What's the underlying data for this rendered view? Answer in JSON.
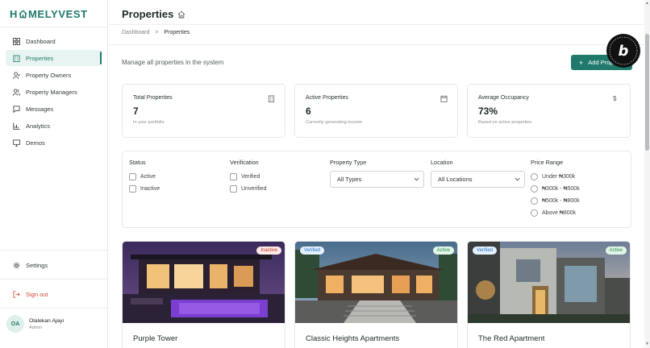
{
  "brand": {
    "logo_left": "H",
    "logo_right": "MELYVEST",
    "accent": "#1f7a6b"
  },
  "sidebar": {
    "items": [
      {
        "label": "Dashboard",
        "icon": "dashboard-icon"
      },
      {
        "label": "Properties",
        "icon": "building-icon",
        "active": true
      },
      {
        "label": "Property Owners",
        "icon": "user-check-icon"
      },
      {
        "label": "Property Managers",
        "icon": "users-icon"
      },
      {
        "label": "Messages",
        "icon": "message-icon"
      },
      {
        "label": "Analytics",
        "icon": "bar-chart-icon"
      },
      {
        "label": "Demos",
        "icon": "monitor-icon"
      }
    ],
    "settings_label": "Settings",
    "signout_label": "Sign out",
    "user": {
      "initials": "OA",
      "name": "Olalekan Ajayi",
      "role": "Admin"
    }
  },
  "header": {
    "title": "Properties"
  },
  "breadcrumb": {
    "home": "Dashboard",
    "sep": ">",
    "current": "Properties"
  },
  "subtitle": "Manage all properties in the system",
  "add_button": {
    "label": "Add Property",
    "plus": "+"
  },
  "stats": [
    {
      "label": "Total Properties",
      "value": "7",
      "sub": "In your portfolio",
      "icon": "building-icon"
    },
    {
      "label": "Active Properties",
      "value": "6",
      "sub": "Currently generating income",
      "icon": "calendar-icon"
    },
    {
      "label": "Average Occupancy",
      "value": "73%",
      "sub": "Based on active properties",
      "icon": "dollar-icon"
    }
  ],
  "filters": {
    "status": {
      "title": "Status",
      "options": [
        "Active",
        "Inactive"
      ]
    },
    "verification": {
      "title": "Verification",
      "options": [
        "Verified",
        "Unverified"
      ]
    },
    "property_type": {
      "title": "Property Type",
      "selected": "All Types"
    },
    "location": {
      "title": "Location",
      "selected": "All Locations"
    },
    "price_range": {
      "title": "Price Range",
      "options": [
        "Under ₦300k",
        "₦300k - ₦500k",
        "₦500k - ₦800k",
        "Above ₦800k"
      ]
    }
  },
  "properties": [
    {
      "name": "Purple Tower",
      "badges": {
        "status": "Inactive"
      }
    },
    {
      "name": "Classic Heights Apartments",
      "badges": {
        "verification": "Verified",
        "status": "Active"
      }
    },
    {
      "name": "The Red Apartment",
      "badges": {
        "verification": "Verified",
        "status": "Active"
      }
    }
  ],
  "bolt_badge": {
    "letter": "b"
  }
}
